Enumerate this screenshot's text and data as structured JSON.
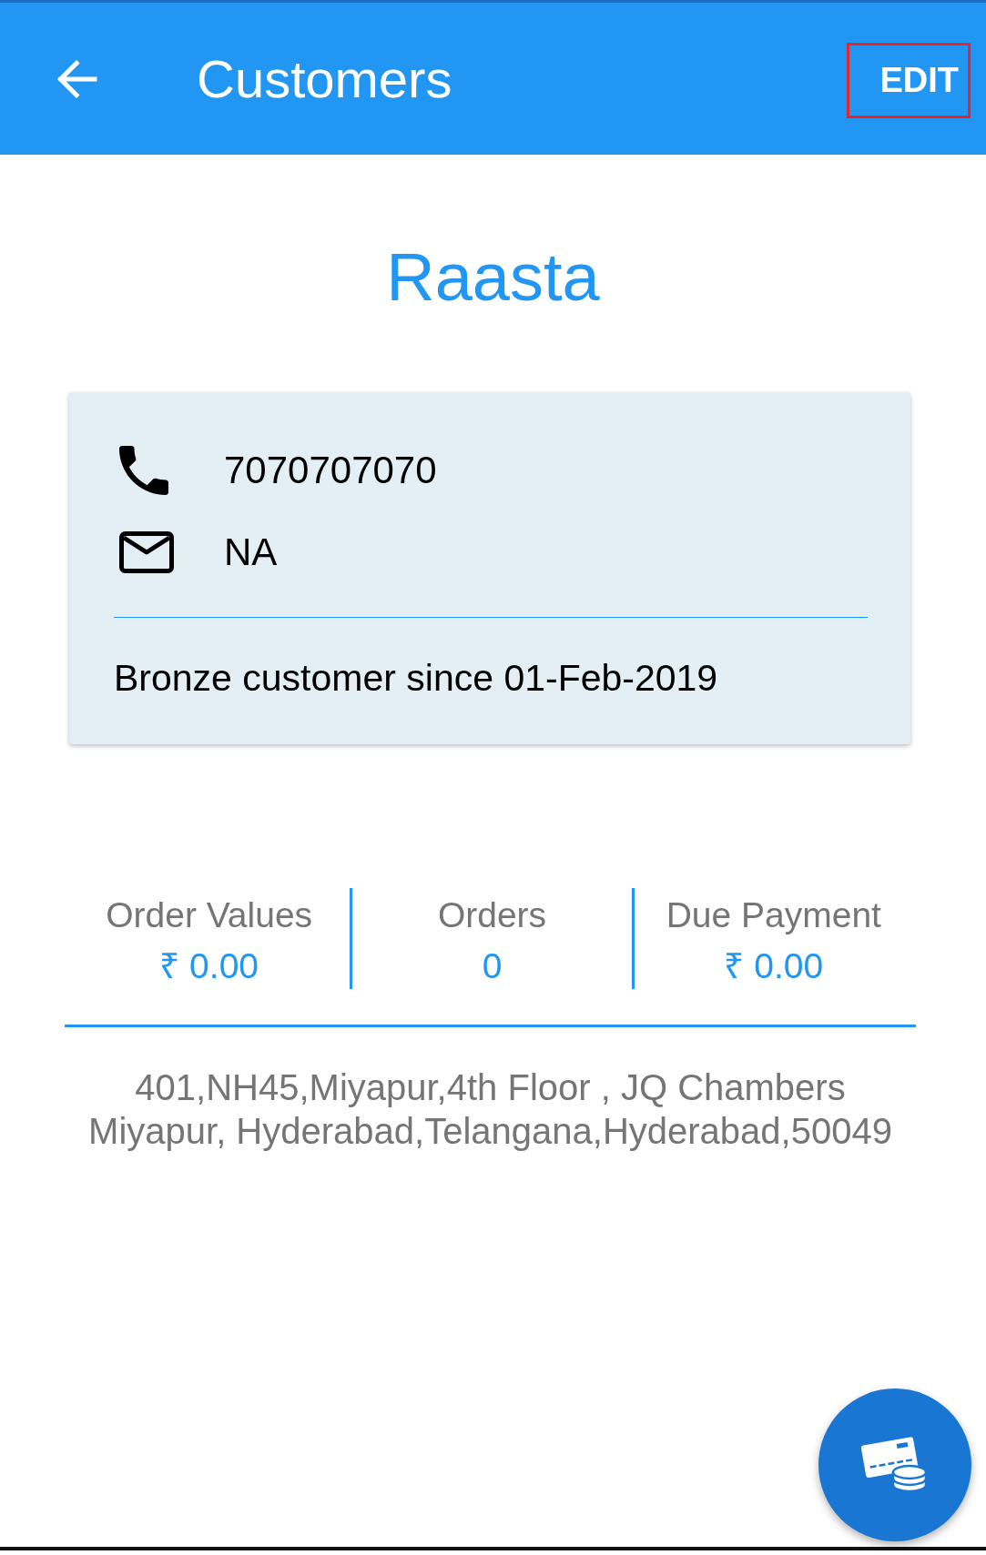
{
  "app_bar": {
    "title": "Customers",
    "action": {
      "label": "EDIT",
      "highlighted": true
    }
  },
  "customer": {
    "name": "Raasta",
    "contacts": [
      {
        "kind": "phone",
        "value": "7070707070"
      },
      {
        "kind": "email",
        "value": "NA"
      }
    ],
    "membership": "Bronze customer since 01-Feb-2019"
  },
  "stats": [
    {
      "label": "Order Values",
      "value": "₹ 0.00"
    },
    {
      "label": "Orders",
      "value": "0"
    },
    {
      "label": "Due Payment",
      "value": "₹ 0.00"
    }
  ],
  "address": "401,NH45,Miyapur,4th Floor , JQ Chambers\nMiyapur, Hyderabad,Telangana,Hyderabad,50049"
}
